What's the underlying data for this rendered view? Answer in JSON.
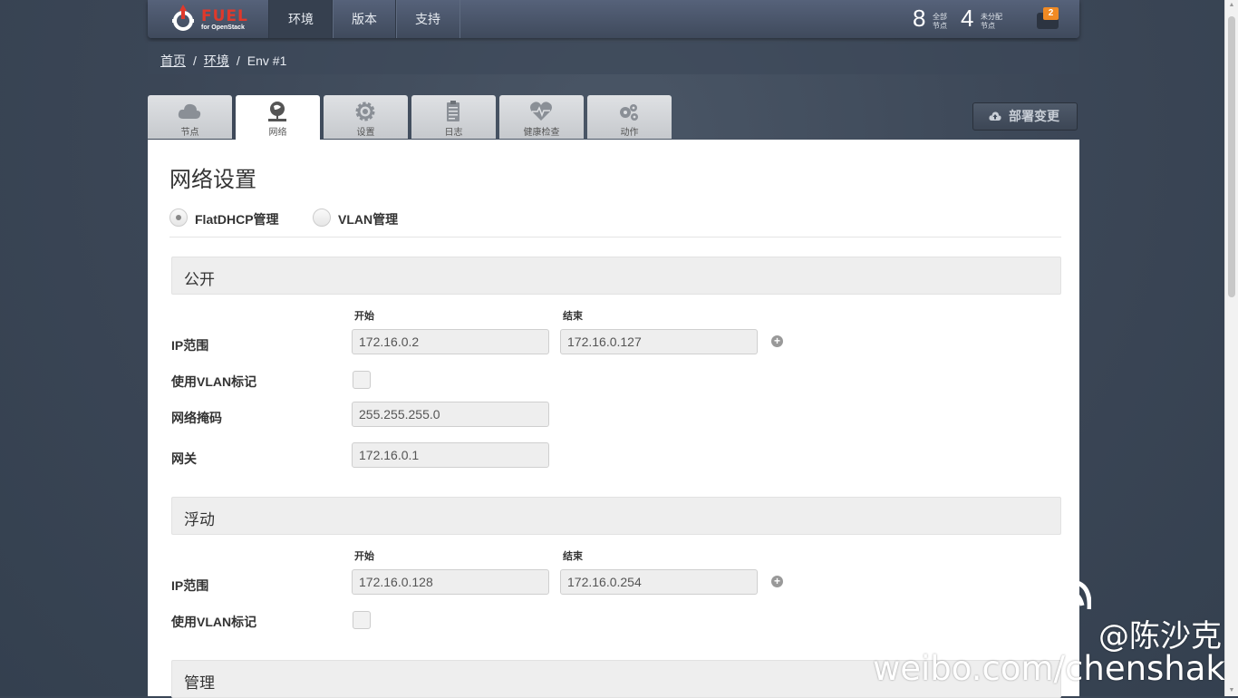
{
  "nav": {
    "brand": "FUEL",
    "brand_sub": "for OpenStack",
    "tabs": [
      {
        "label": "环境",
        "active": true
      },
      {
        "label": "版本",
        "active": false
      },
      {
        "label": "支持",
        "active": false
      }
    ],
    "counters": [
      {
        "value": "8",
        "line1": "全部",
        "line2": "节点"
      },
      {
        "value": "4",
        "line1": "未分配",
        "line2": "节点"
      }
    ],
    "notifications": "2"
  },
  "breadcrumb": {
    "home": "首页",
    "envs": "环境",
    "current": "Env #1",
    "sep": "/"
  },
  "tabs": [
    {
      "label": "节点",
      "icon": "cloud-icon"
    },
    {
      "label": "网络",
      "icon": "network-icon",
      "active": true
    },
    {
      "label": "设置",
      "icon": "gear-icon"
    },
    {
      "label": "日志",
      "icon": "clipboard-icon"
    },
    {
      "label": "健康检查",
      "icon": "heart-icon"
    },
    {
      "label": "动作",
      "icon": "cogs-icon"
    }
  ],
  "deploy_button": "部署变更",
  "page": {
    "title": "网络设置",
    "managers": [
      {
        "label": "FlatDHCP管理",
        "selected": true
      },
      {
        "label": "VLAN管理",
        "selected": false
      }
    ]
  },
  "labels": {
    "start": "开始",
    "end": "结束",
    "ip_range": "IP范围",
    "use_vlan": "使用VLAN标记",
    "netmask": "网络掩码",
    "gateway": "网关"
  },
  "sections": {
    "public": {
      "title": "公开",
      "ip_start": "172.16.0.2",
      "ip_end": "172.16.0.127",
      "vlan_tagging": false,
      "netmask": "255.255.255.0",
      "gateway": "172.16.0.1"
    },
    "floating": {
      "title": "浮动",
      "ip_start": "172.16.0.128",
      "ip_end": "172.16.0.254",
      "vlan_tagging": false
    },
    "management": {
      "title": "管理"
    }
  },
  "watermark": {
    "handle": "@陈沙克",
    "url": "weibo.com/chenshake"
  },
  "colors": {
    "brand_red": "#e0392b",
    "badge_orange": "#f08a24",
    "nav_bg": "#4a5568"
  }
}
